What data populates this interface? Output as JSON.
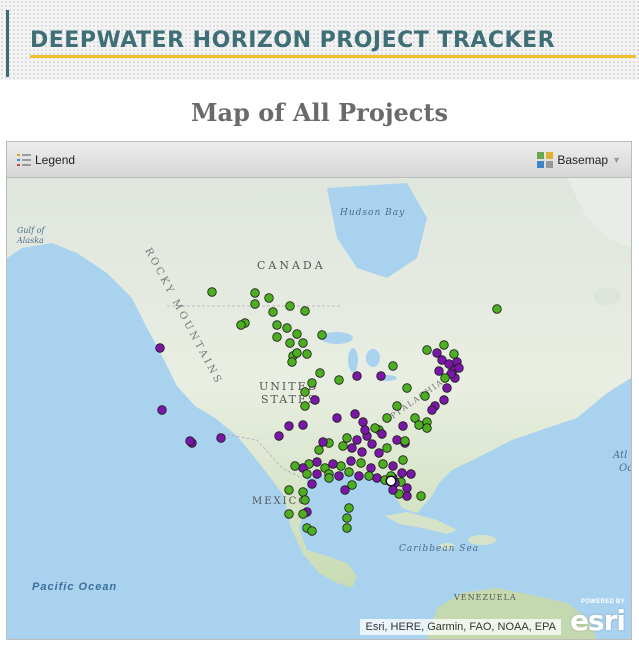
{
  "header": {
    "title": "DEEPWATER HORIZON PROJECT TRACKER"
  },
  "page": {
    "title": "Map of All Projects"
  },
  "toolbar": {
    "legend_label": "Legend",
    "basemap_label": "Basemap"
  },
  "map": {
    "labels": {
      "canada": "CANADA",
      "rocky_mountains": "ROCKY MOUNTAINS",
      "united_states_1": "UNITED",
      "united_states_2": "STATES",
      "mexico": "MEXICO",
      "hudson_bay": "Hudson Bay",
      "gulf_of_alaska_1": "Gulf of",
      "gulf_of_alaska_2": "Alaska",
      "pacific_ocean": "Pacific Ocean",
      "caribbean_sea": "Caribbean Sea",
      "venezuela": "VENEZUELA",
      "appalachian": "APPALACHIAN",
      "atlantic_1": "Atl",
      "atlantic_2": "Oc"
    },
    "attribution": "Esri, HERE, Garmin, FAO, NOAA, EPA",
    "esri_powered": "POWERED BY",
    "esri_logo": "esri",
    "colors": {
      "green": "#4caf1f",
      "purple": "#7a17a8",
      "highlight": "#ffffff"
    }
  }
}
